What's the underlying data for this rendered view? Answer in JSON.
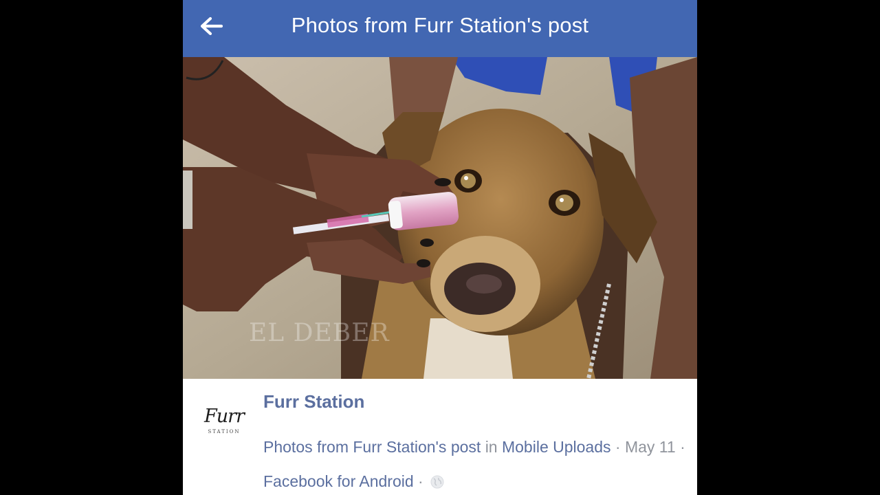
{
  "header": {
    "back_icon": "back-arrow-icon",
    "title": "Photos from Furr Station's post",
    "background": "#4267b2"
  },
  "photo": {
    "watermark": "EL DEBER"
  },
  "post": {
    "avatar_text": "Furr",
    "avatar_subtext": "STATION",
    "page_name": "Furr Station",
    "album_text": "Photos from Furr Station's post",
    "in_text": "in",
    "album_link": "Mobile Uploads",
    "sep1": "·",
    "date": "May 11",
    "sep2": "·",
    "source": "Facebook for Android",
    "sep3": "·",
    "privacy_icon": "globe-icon",
    "link_color": "#5b6f9f",
    "meta_color": "#90949c"
  }
}
